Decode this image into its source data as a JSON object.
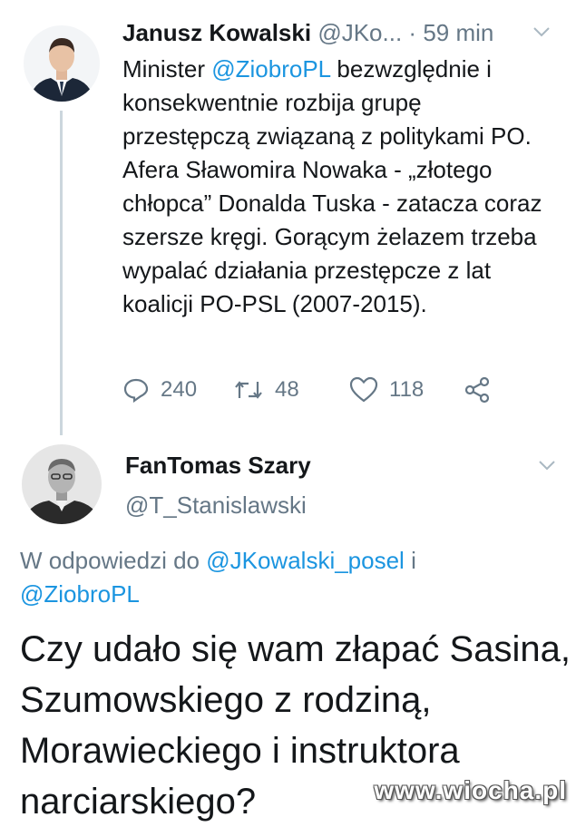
{
  "tweet1": {
    "name": "Janusz Kowalski",
    "handle": "@JKo...",
    "separator": "·",
    "time": "59 min",
    "avatar_icon": "person-avatar-icon",
    "mention": "@ZiobroPL",
    "body_pre": "Minister ",
    "body_post": " bezwzględnie i konsekwentnie rozbija grupę przestępczą związaną z politykami PO. Afera Sławomira Nowaka - „złotego chłopca” Donalda Tuska - zatacza coraz szersze kręgi. Gorącym żelazem trzeba wypalać działania przestępcze z lat koalicji PO-PSL (2007-2015).",
    "actions": {
      "reply_count": "240",
      "retweet_count": "48",
      "like_count": "118"
    }
  },
  "tweet2": {
    "name": "FanTomas Szary",
    "handle": "@T_Stanislawski",
    "reply_prefix": "W odpowiedzi do ",
    "reply_mention1": "@JKowalski_posel",
    "reply_and": " i",
    "reply_mention2": "@ZiobroPL",
    "body": "Czy udało się wam złapać Sasina, Szumowskiego z rodziną, Morawieckiego i instruktora narciarskiego?"
  },
  "watermark": "www.wiocha.pl",
  "colors": {
    "link": "#1b95e0",
    "secondary": "#657786",
    "text": "#14171a"
  }
}
